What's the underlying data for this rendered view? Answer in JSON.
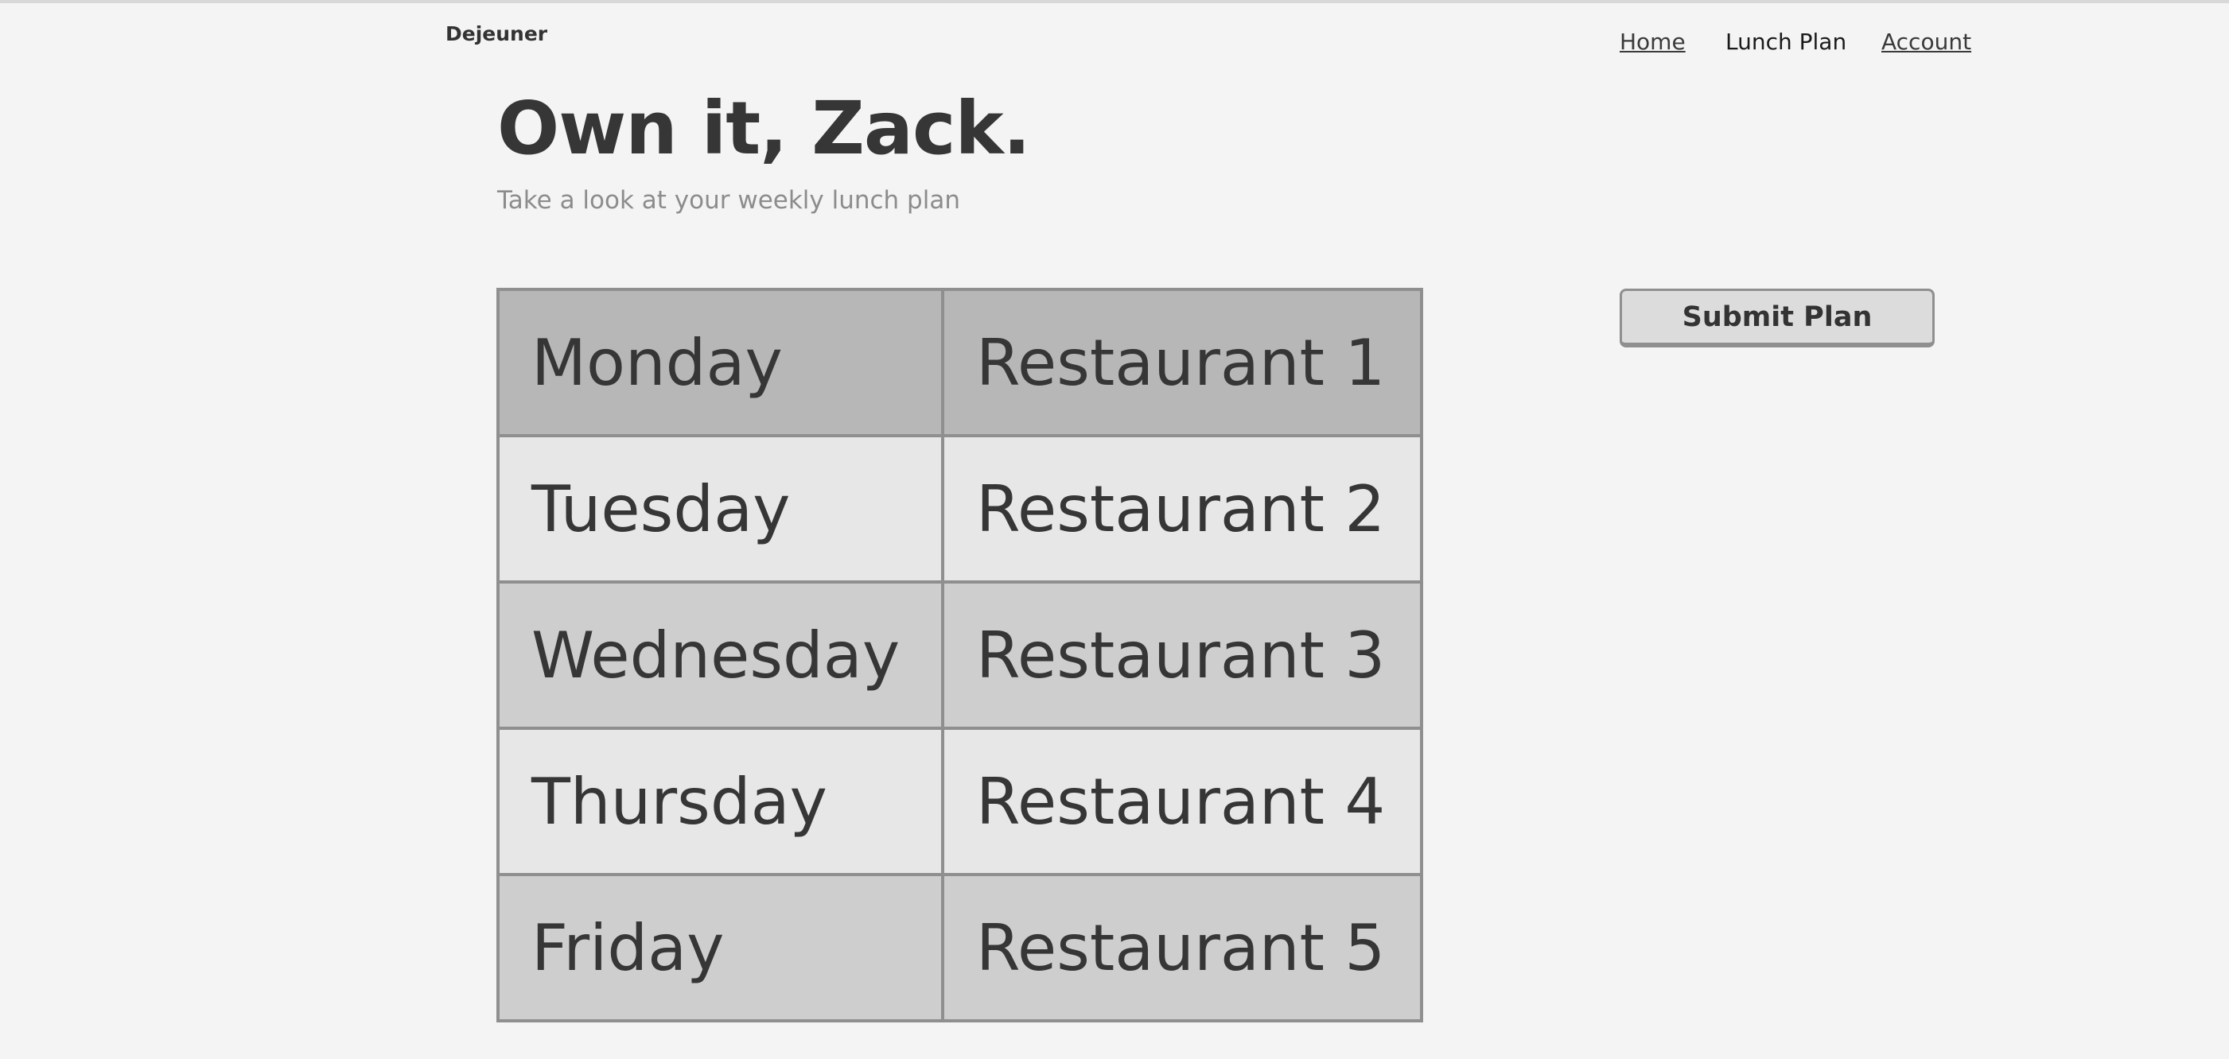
{
  "app": {
    "brand": "Dejeuner"
  },
  "nav": {
    "items": [
      {
        "label": "Home"
      },
      {
        "label": "Lunch Plan"
      },
      {
        "label": "Account"
      }
    ]
  },
  "hero": {
    "title": "Own it, Zack.",
    "subtitle": "Take a look at your weekly lunch plan"
  },
  "plan": {
    "rows": [
      {
        "day": "Monday",
        "restaurant": "Restaurant 1"
      },
      {
        "day": "Tuesday",
        "restaurant": "Restaurant 2"
      },
      {
        "day": "Wednesday",
        "restaurant": "Restaurant 3"
      },
      {
        "day": "Thursday",
        "restaurant": "Restaurant 4"
      },
      {
        "day": "Friday",
        "restaurant": "Restaurant 5"
      }
    ]
  },
  "actions": {
    "submit_label": "Submit Plan"
  },
  "colors": {
    "background": "#f4f4f4",
    "row_dark": "#b7b7b7",
    "row_mid": "#cecece",
    "row_light": "#e7e7e7",
    "border": "#8f8f8f",
    "text": "#363636"
  }
}
